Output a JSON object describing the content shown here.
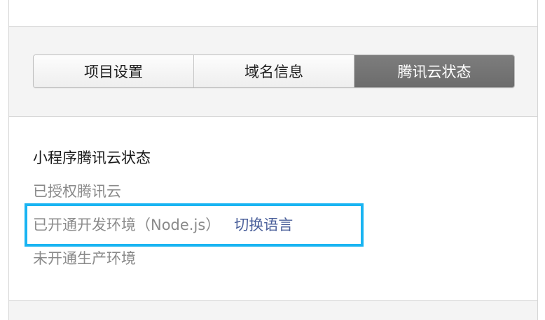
{
  "tabs": [
    {
      "label": "项目设置",
      "active": false
    },
    {
      "label": "域名信息",
      "active": false
    },
    {
      "label": "腾讯云状态",
      "active": true
    }
  ],
  "status": {
    "title": "小程序腾讯云状态",
    "authorized": "已授权腾讯云",
    "dev_env": "已开通开发环境（Node.js）",
    "switch_language": "切换语言",
    "prod_env": "未开通生产环境"
  },
  "colors": {
    "active_tab_bg": "#747474",
    "link": "#4a5f9a",
    "highlight_border": "#19b4f2"
  }
}
